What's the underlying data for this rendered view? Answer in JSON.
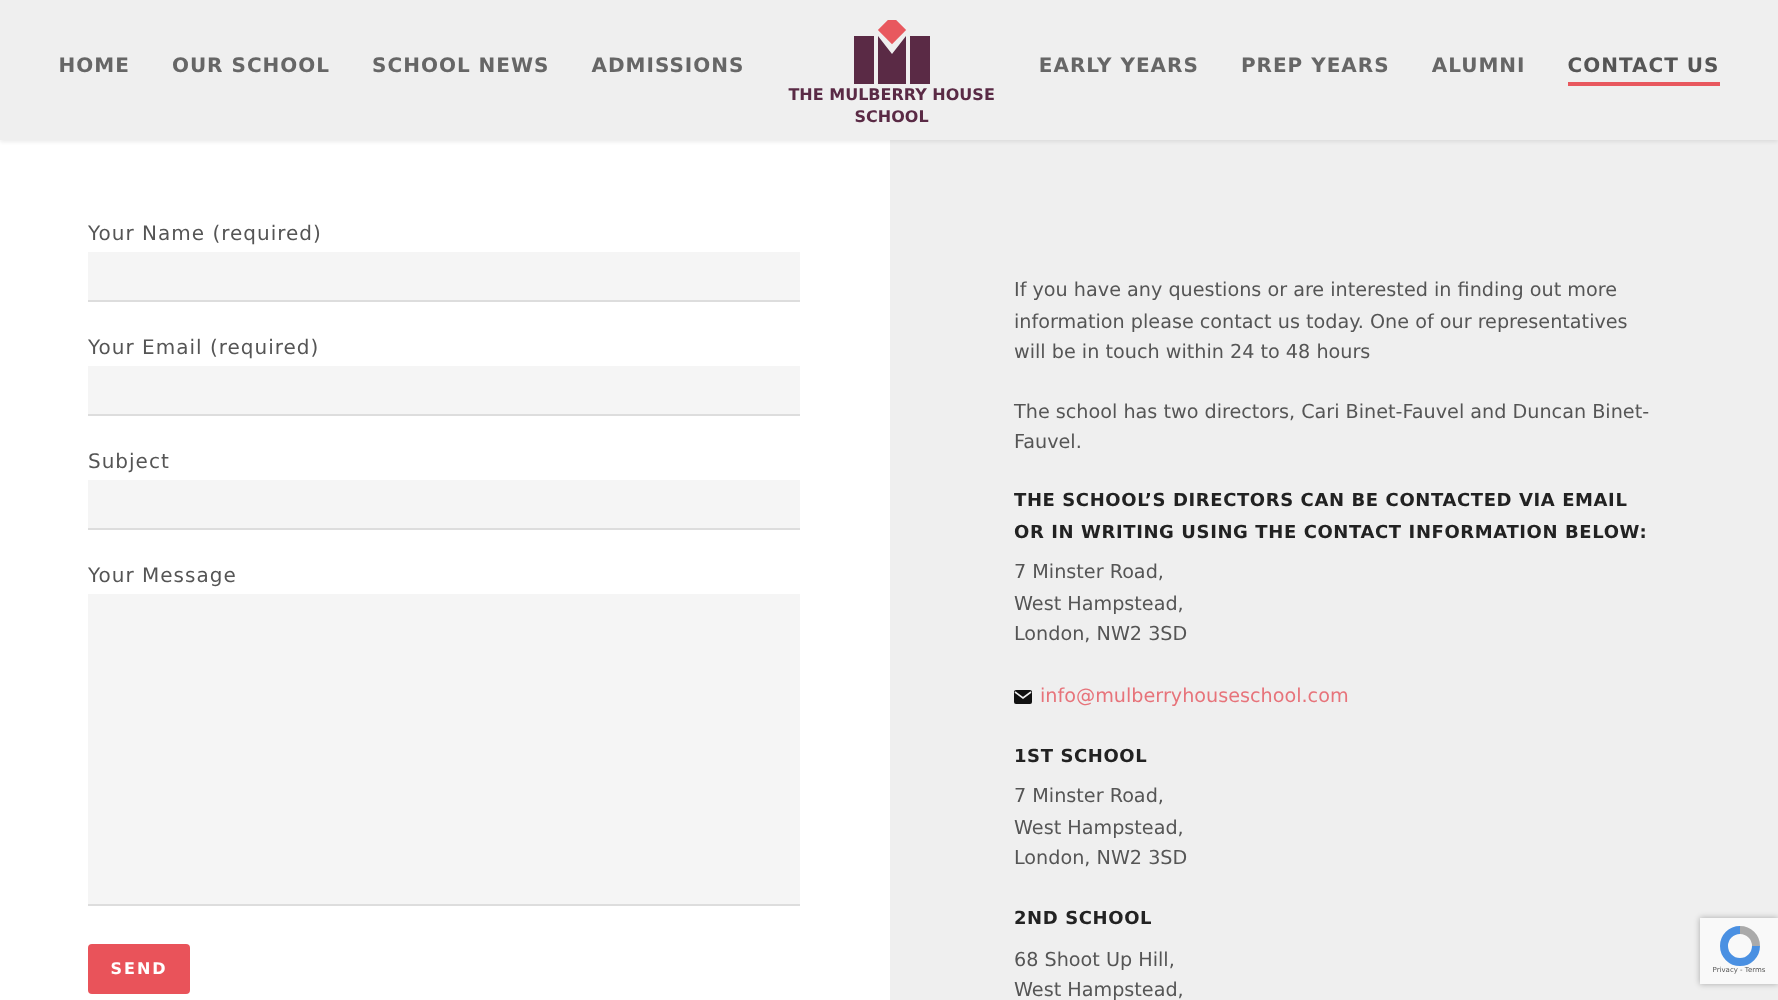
{
  "nav_left": [
    {
      "label": "HOME",
      "selected": false
    },
    {
      "label": "OUR SCHOOL",
      "selected": false
    },
    {
      "label": "SCHOOL NEWS",
      "selected": false
    },
    {
      "label": "ADMISSIONS",
      "selected": false
    }
  ],
  "logo": {
    "name_line_1": "THE MULBERRY HOUSE",
    "name_line_2": "SCHOOL"
  },
  "nav_right": [
    {
      "label": "EARLY YEARS",
      "selected": false
    },
    {
      "label": "PREP YEARS",
      "selected": false
    },
    {
      "label": "ALUMNI",
      "selected": false
    },
    {
      "label": "CONTACT US",
      "selected": true
    }
  ],
  "form": {
    "fields": [
      {
        "label": "Your Name (required)",
        "kind": "input"
      },
      {
        "label": "Your Email (required)",
        "kind": "input"
      },
      {
        "label": "Subject",
        "kind": "input"
      },
      {
        "label": "Your Message",
        "kind": "textarea"
      }
    ],
    "submit": "SEND"
  },
  "contact": {
    "intro": "If you have any questions or are interested in finding out more information please contact us today. One of our representatives will be in touch within 24 to 48 hours",
    "directors": "The school has two directors, Cari Binet-Fauvel and Duncan Binet-Fauvel.",
    "heading": "THE SCHOOL’S DIRECTORS CAN BE CONTACTED VIA EMAIL OR IN WRITING USING THE CONTACT INFORMATION BELOW:",
    "address": [
      "7 Minster Road,",
      "West Hampstead,",
      "London, NW2 3SD"
    ],
    "email": "info@mulberryhouseschool.com",
    "schools": [
      {
        "title": "1ST SCHOOL",
        "address": [
          "7 Minster Road,",
          "West Hampstead,",
          "London, NW2 3SD"
        ]
      },
      {
        "title": "2ND SCHOOL",
        "address": [
          "68 Shoot Up Hill,",
          "West Hampstead,"
        ]
      }
    ]
  },
  "recaptcha": {
    "links": "Privacy - Terms"
  }
}
